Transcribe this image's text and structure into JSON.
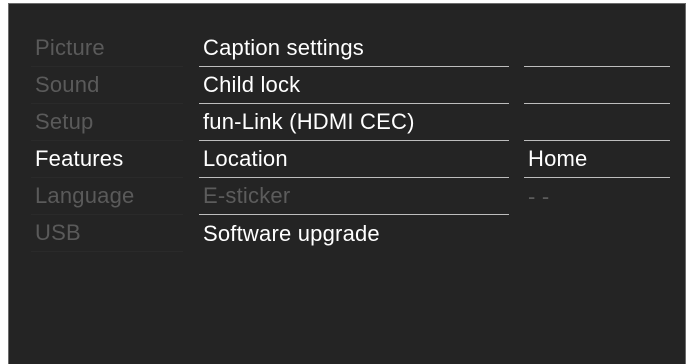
{
  "menu": {
    "categories": [
      {
        "label": "Picture",
        "active": false
      },
      {
        "label": "Sound",
        "active": false
      },
      {
        "label": "Setup",
        "active": false
      },
      {
        "label": "Features",
        "active": true
      },
      {
        "label": "Language",
        "active": false
      },
      {
        "label": "USB",
        "active": false
      }
    ],
    "items": [
      {
        "label": "Caption settings",
        "enabled": true
      },
      {
        "label": "Child lock",
        "enabled": true
      },
      {
        "label": "fun-Link (HDMI CEC)",
        "enabled": true
      },
      {
        "label": "Location",
        "enabled": true
      },
      {
        "label": "E-sticker",
        "enabled": false
      },
      {
        "label": "Software upgrade",
        "enabled": true
      }
    ],
    "values": [
      {
        "label": ""
      },
      {
        "label": ""
      },
      {
        "label": ""
      },
      {
        "label": "Home"
      },
      {
        "label": "- -"
      },
      {
        "label": ""
      }
    ]
  },
  "colors": {
    "panel_background": "#242424",
    "active_text": "#ffffff",
    "inactive_text": "#5c5c5c",
    "separator": "#bdbdbd"
  }
}
